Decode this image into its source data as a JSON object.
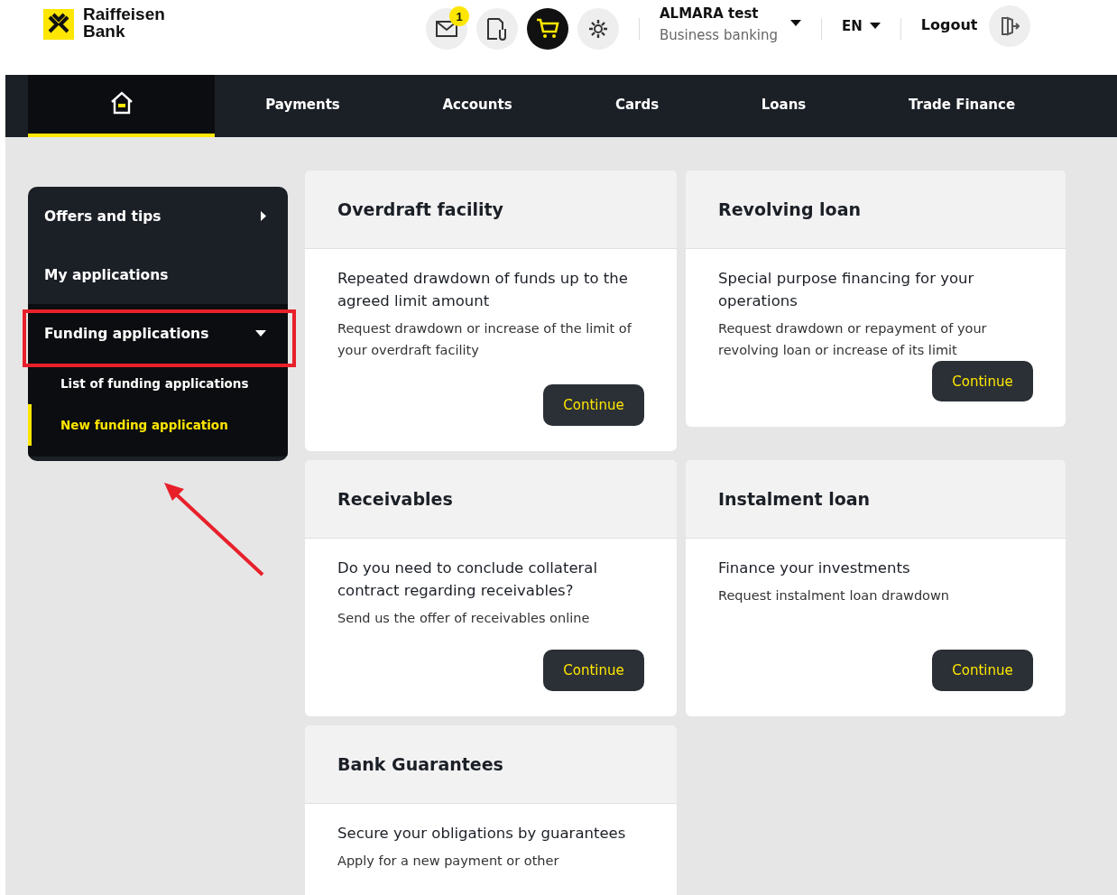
{
  "brand": {
    "name_line1": "Raiffeisen",
    "name_line2": "Bank"
  },
  "header": {
    "mail_badge": "1",
    "user_name": "ALMARA test",
    "user_role": "Business banking",
    "language": "EN",
    "logout": "Logout"
  },
  "nav": [
    {
      "kind": "home",
      "selected": true
    },
    {
      "kind": "text",
      "label": "Payments",
      "selected": false
    },
    {
      "kind": "text",
      "label": "Accounts",
      "selected": false
    },
    {
      "kind": "text",
      "label": "Cards",
      "selected": false
    },
    {
      "kind": "text",
      "label": "Loans",
      "selected": false
    },
    {
      "kind": "text",
      "label": "Trade Finance",
      "selected": false
    }
  ],
  "sidebar": {
    "items": [
      {
        "label": "Offers and tips",
        "expanded": false,
        "highlighted": false
      },
      {
        "label": "My applications",
        "highlighted": false
      },
      {
        "label": "Funding applications",
        "expanded": true,
        "highlighted": true,
        "children": [
          {
            "label": "List of funding applications",
            "selected": false
          },
          {
            "label": "New funding application",
            "selected": true
          }
        ]
      }
    ]
  },
  "cards": [
    {
      "title": "Overdraft facility",
      "lead": "Repeated drawdown of funds up to the agreed limit amount",
      "text": "Request drawdown or increase of the limit of your overdraft facility",
      "button": "Continue"
    },
    {
      "title": "Revolving loan",
      "lead": "Special purpose financing for your operations",
      "text": "Request drawdown or repayment of your revolving loan or increase of its limit",
      "button": "Continue"
    },
    {
      "title": "Receivables",
      "lead": "Do you need to conclude collateral contract regarding receivables?",
      "text": "Send us the offer of receivables online",
      "button": "Continue"
    },
    {
      "title": "Instalment loan",
      "lead": "Finance your investments",
      "text": "Request instalment loan drawdown",
      "button": "Continue"
    },
    {
      "title": "Bank Guarantees",
      "lead": "Secure your obligations by guarantees",
      "text": "Apply for a new payment or other"
    }
  ]
}
